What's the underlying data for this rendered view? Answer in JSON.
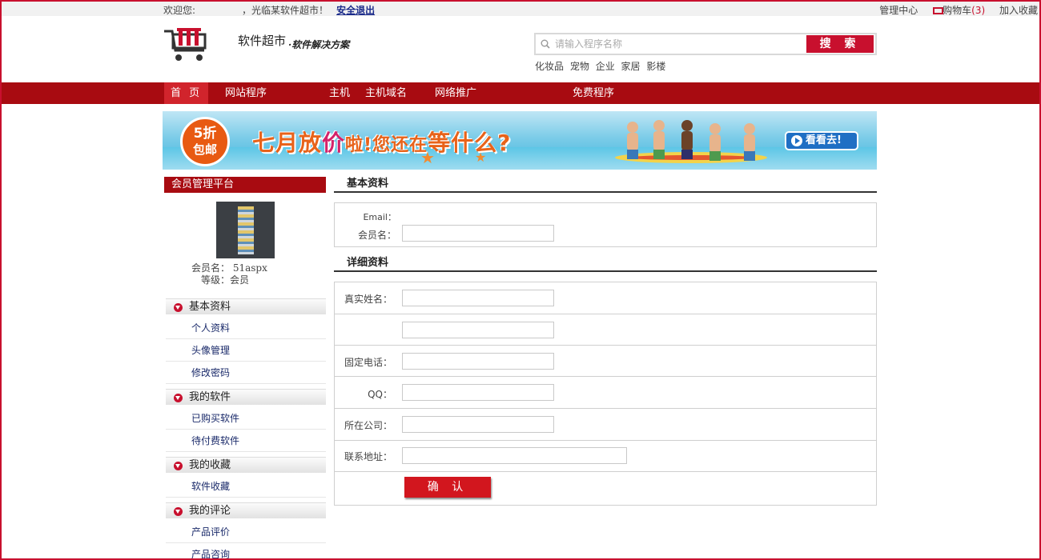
{
  "topbar": {
    "welcome": "欢迎您:",
    "visit": "，光临某软件超市！",
    "logout": "安全退出",
    "admin": "管理中心",
    "cart": "购物车",
    "cart_count": "(3)",
    "favorite": "加入收藏"
  },
  "header": {
    "site_title": "软件超市",
    "slogan": "·软件解决方案"
  },
  "search": {
    "placeholder": "请输入程序名称",
    "button": "搜 索",
    "hot": [
      "化妆品",
      "宠物",
      "企业",
      "家居",
      "影楼"
    ]
  },
  "nav": {
    "home": "首 页",
    "items": [
      "网站程序",
      "主机",
      "主机域名",
      "网络推广",
      "免费程序"
    ]
  },
  "banner": {
    "badge_top": "5折",
    "badge_bottom": "包邮",
    "headline_a": "七月放",
    "headline_b": "价",
    "headline_c": "啦!",
    "headline_d": "您还在",
    "headline_e": "等什么?",
    "button": "看看去!"
  },
  "sidebar": {
    "title": "会员管理平台",
    "member_label": "会员名：",
    "member_value": "51aspx",
    "level_label": "等级：",
    "level_value": "会员",
    "groups": [
      {
        "title": "基本资料",
        "links": [
          "个人资料",
          "头像管理",
          "修改密码"
        ]
      },
      {
        "title": "我的软件",
        "links": [
          "已购买软件",
          "待付费软件"
        ]
      },
      {
        "title": "我的收藏",
        "links": [
          "软件收藏"
        ]
      },
      {
        "title": "我的评论",
        "links": [
          "产品评价",
          "产品咨询"
        ]
      }
    ]
  },
  "form": {
    "basic_title": "基本资料",
    "email_label": "Email：",
    "member_label": "会员名：",
    "detail_title": "详细资料",
    "realname_label": "真实姓名：",
    "phone_label": "固定电话：",
    "qq_label": "QQ：",
    "company_label": "所在公司：",
    "address_label": "联系地址：",
    "confirm": "确 认"
  },
  "colors": {
    "brand_red": "#a80b11",
    "accent_red": "#c8102e"
  }
}
